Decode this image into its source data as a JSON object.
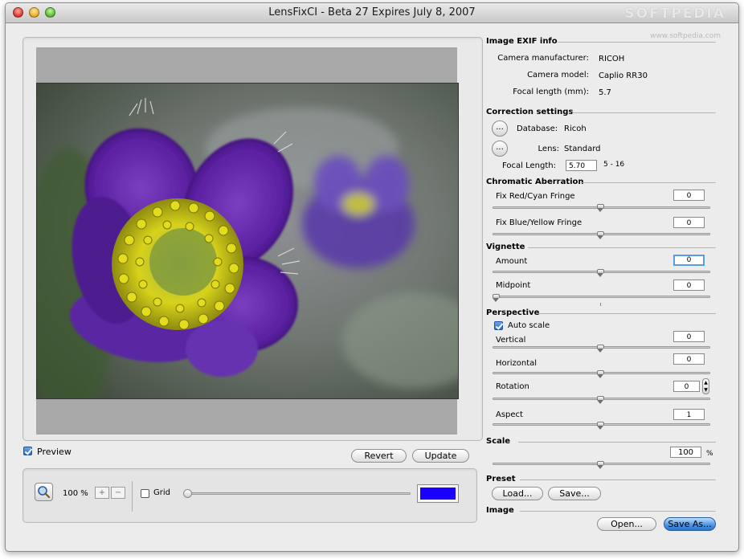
{
  "window": {
    "title": "LensFixCI - Beta 27 Expires July 8, 2007"
  },
  "watermark": {
    "brand": "SOFTPEDIA",
    "url": "www.softpedia.com"
  },
  "preview": {
    "checkbox_label": "Preview",
    "checked": true,
    "revert_label": "Revert",
    "update_label": "Update",
    "zoom_text": "100 %",
    "zoom_in": "+",
    "zoom_out": "−",
    "grid_label": "Grid",
    "grid_checked": false,
    "grid_color": "#1a00ff",
    "grid_slider_value": 0
  },
  "exif": {
    "header": "Image EXIF info",
    "manufacturer_label": "Camera manufacturer:",
    "manufacturer": "RICOH",
    "model_label": "Camera model:",
    "model": "Caplio RR30",
    "focal_label": "Focal length (mm):",
    "focal": "5.7"
  },
  "correction": {
    "header": "Correction settings",
    "database_label": "Database:",
    "database": "Ricoh",
    "lens_label": "Lens:",
    "lens": "Standard",
    "focal_length_label": "Focal Length:",
    "focal_length_value": "5.70",
    "focal_range": "5 - 16",
    "browse_button": "..."
  },
  "chromatic": {
    "header": "Chromatic Aberration",
    "red_cyan_label": "Fix Red/Cyan Fringe",
    "red_cyan_value": "0",
    "blue_yellow_label": "Fix Blue/Yellow Fringe",
    "blue_yellow_value": "0"
  },
  "vignette": {
    "header": "Vignette",
    "amount_label": "Amount",
    "amount_value": "0",
    "midpoint_label": "Midpoint",
    "midpoint_value": "0"
  },
  "perspective": {
    "header": "Perspective",
    "auto_scale_label": "Auto scale",
    "auto_scale_checked": true,
    "vertical_label": "Vertical",
    "vertical_value": "0",
    "horizontal_label": "Horizontal",
    "horizontal_value": "0",
    "rotation_label": "Rotation",
    "rotation_value": "0",
    "aspect_label": "Aspect",
    "aspect_value": "1"
  },
  "scale": {
    "header": "Scale",
    "value": "100",
    "unit": "%"
  },
  "preset": {
    "header": "Preset",
    "load_label": "Load...",
    "save_label": "Save..."
  },
  "image": {
    "header": "Image",
    "open_label": "Open...",
    "save_as_label": "Save As..."
  }
}
